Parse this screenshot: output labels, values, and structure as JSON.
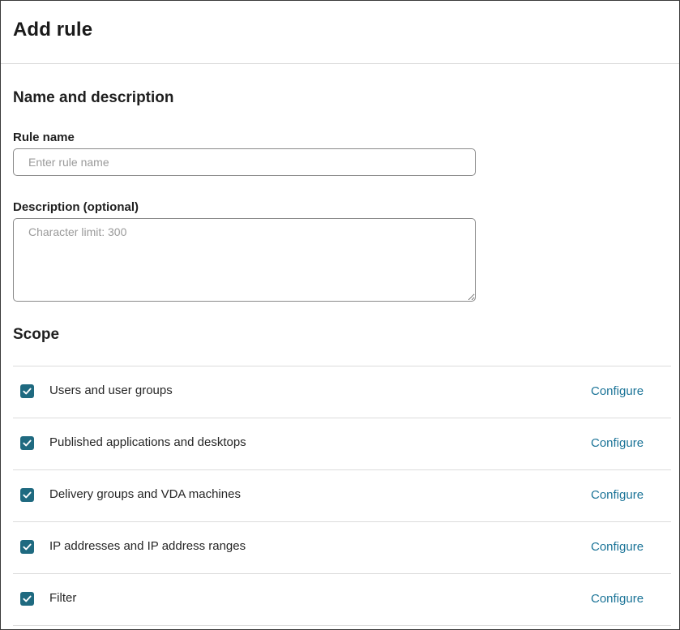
{
  "dialog": {
    "title": "Add rule"
  },
  "name_section": {
    "title": "Name and description",
    "rule_name_label": "Rule name",
    "rule_name_placeholder": "Enter rule name",
    "rule_name_value": "",
    "description_label": "Description (optional)",
    "description_placeholder": "Character limit: 300",
    "description_value": ""
  },
  "scope_section": {
    "title": "Scope",
    "items": [
      {
        "label": "Users and user groups",
        "checked": true,
        "action": "Configure"
      },
      {
        "label": "Published applications and desktops",
        "checked": true,
        "action": "Configure"
      },
      {
        "label": "Delivery groups and VDA machines",
        "checked": true,
        "action": "Configure"
      },
      {
        "label": "IP addresses and IP address ranges",
        "checked": true,
        "action": "Configure"
      },
      {
        "label": "Filter",
        "checked": true,
        "action": "Configure"
      }
    ]
  },
  "colors": {
    "accent": "#1f6a80",
    "link": "#1a7397",
    "divider": "#dcdcdc"
  },
  "icons": {
    "checkbox_mark": "checkmark-icon"
  }
}
